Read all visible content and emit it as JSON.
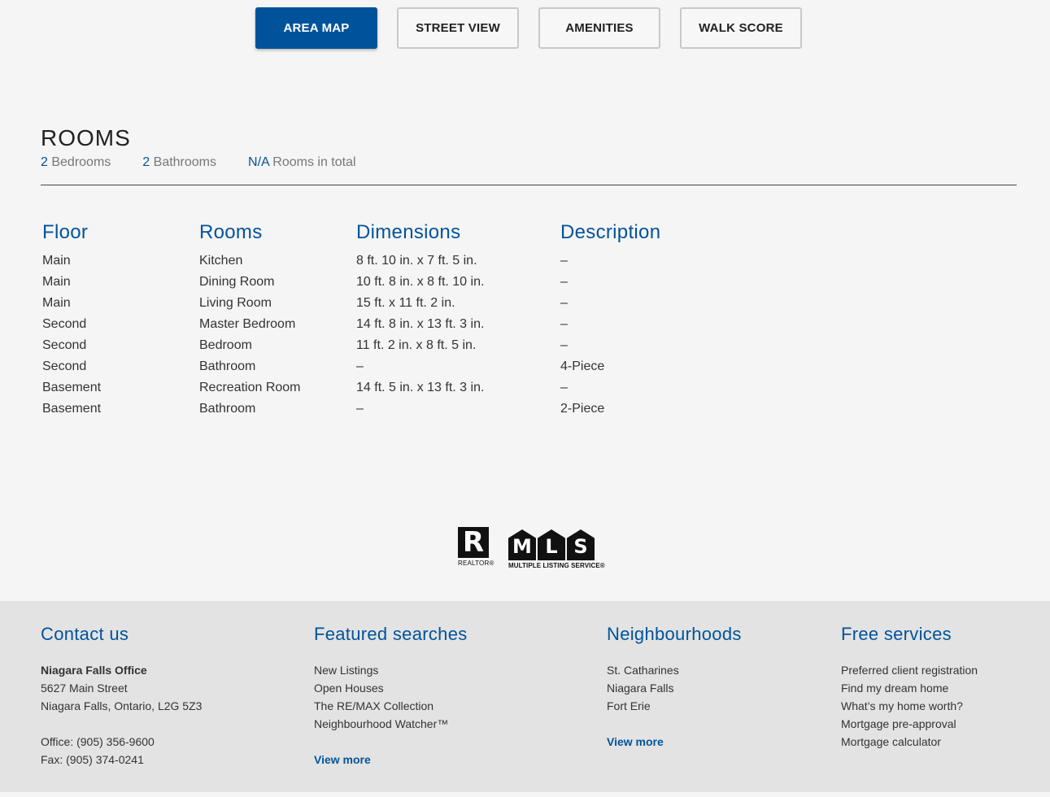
{
  "map_tabs": [
    {
      "label": "AREA MAP",
      "active": true
    },
    {
      "label": "STREET VIEW",
      "active": false
    },
    {
      "label": "AMENITIES",
      "active": false
    },
    {
      "label": "WALK SCORE",
      "active": false
    }
  ],
  "rooms": {
    "title": "ROOMS",
    "summary": {
      "bedrooms_count": "2",
      "bedrooms_label": "Bedrooms",
      "bathrooms_count": "2",
      "bathrooms_label": "Bathrooms",
      "total_count": "N/A",
      "total_label": "Rooms in total"
    },
    "headers": {
      "floor": "Floor",
      "rooms": "Rooms",
      "dimensions": "Dimensions",
      "description": "Description"
    },
    "rows": [
      {
        "floor": "Main",
        "room": "Kitchen",
        "dimensions": "8 ft. 10 in. x 7 ft. 5 in.",
        "description": "–"
      },
      {
        "floor": "Main",
        "room": "Dining Room",
        "dimensions": "10 ft. 8 in. x 8 ft. 10 in.",
        "description": "–"
      },
      {
        "floor": "Main",
        "room": "Living Room",
        "dimensions": "15 ft. x 11 ft. 2 in.",
        "description": "–"
      },
      {
        "floor": "Second",
        "room": "Master Bedroom",
        "dimensions": "14 ft. 8 in. x 13 ft. 3 in.",
        "description": "–"
      },
      {
        "floor": "Second",
        "room": "Bedroom",
        "dimensions": "11 ft. 2 in. x 8 ft. 5 in.",
        "description": "–"
      },
      {
        "floor": "Second",
        "room": "Bathroom",
        "dimensions": "–",
        "description": "4-Piece"
      },
      {
        "floor": "Basement",
        "room": "Recreation Room",
        "dimensions": "14 ft. 5 in. x 13 ft. 3 in.",
        "description": "–"
      },
      {
        "floor": "Basement",
        "room": "Bathroom",
        "dimensions": "–",
        "description": "2-Piece"
      }
    ]
  },
  "logos": {
    "realtor_mark": "R",
    "realtor_text": "REALTOR®",
    "mls_letters": [
      "M",
      "L",
      "S"
    ],
    "mls_text": "MULTIPLE LISTING SERVICE®"
  },
  "footer": {
    "contact": {
      "heading": "Contact us",
      "office_name": "Niagara Falls Office",
      "address_line1": "5627 Main Street",
      "address_line2": "Niagara Falls, Ontario, L2G 5Z3",
      "office_phone": "Office: (905) 356-9600",
      "fax": "Fax: (905) 374-0241"
    },
    "featured": {
      "heading": "Featured searches",
      "links": [
        "New Listings",
        "Open Houses",
        "The RE/MAX Collection",
        "Neighbourhood Watcher™"
      ],
      "view_more": "View more"
    },
    "neighbourhoods": {
      "heading": "Neighbourhoods",
      "links": [
        "St. Catharines",
        "Niagara Falls",
        "Fort Erie"
      ],
      "view_more": "View more"
    },
    "services": {
      "heading": "Free services",
      "links": [
        "Preferred client registration",
        "Find my dream home",
        "What’s my home worth?",
        "Mortgage pre-approval",
        "Mortgage calculator"
      ]
    }
  },
  "colors": {
    "brand_blue": "#00539b",
    "footer_bg": "#e3e3e3",
    "page_bg": "#f5f5f5"
  }
}
